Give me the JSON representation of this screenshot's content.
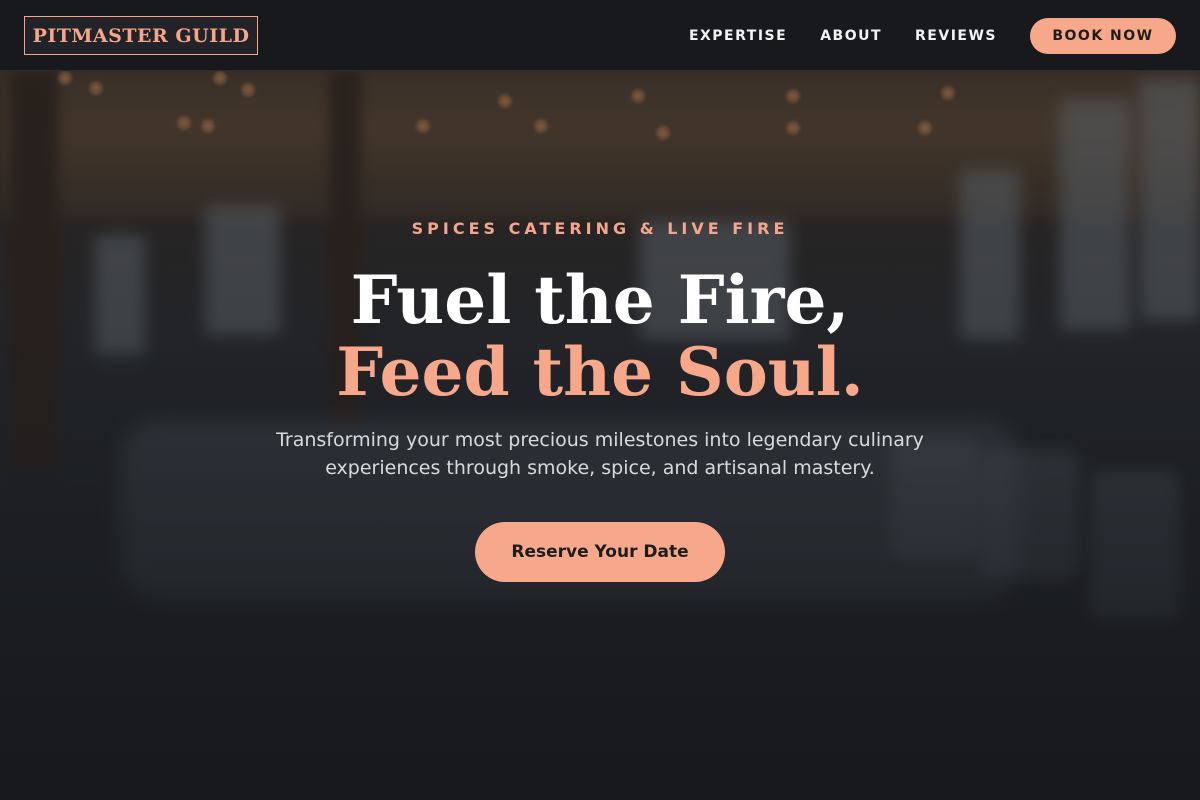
{
  "header": {
    "logo": "PITMASTER GUILD",
    "nav": [
      {
        "label": "EXPERTISE"
      },
      {
        "label": "ABOUT"
      },
      {
        "label": "REVIEWS"
      }
    ],
    "book_button": "BOOK NOW"
  },
  "hero": {
    "eyebrow": "SPICES CATERING & LIVE FIRE",
    "headline_line1": "Fuel the Fire,",
    "headline_line2": "Feed the Soul.",
    "subtitle": "Transforming your most precious milestones into legendary culinary experiences through smoke, spice, and artisanal mastery.",
    "cta": "Reserve Your Date"
  },
  "colors": {
    "accent": "#f7a88b",
    "header_bg": "#17191d",
    "text": "#ffffff"
  }
}
